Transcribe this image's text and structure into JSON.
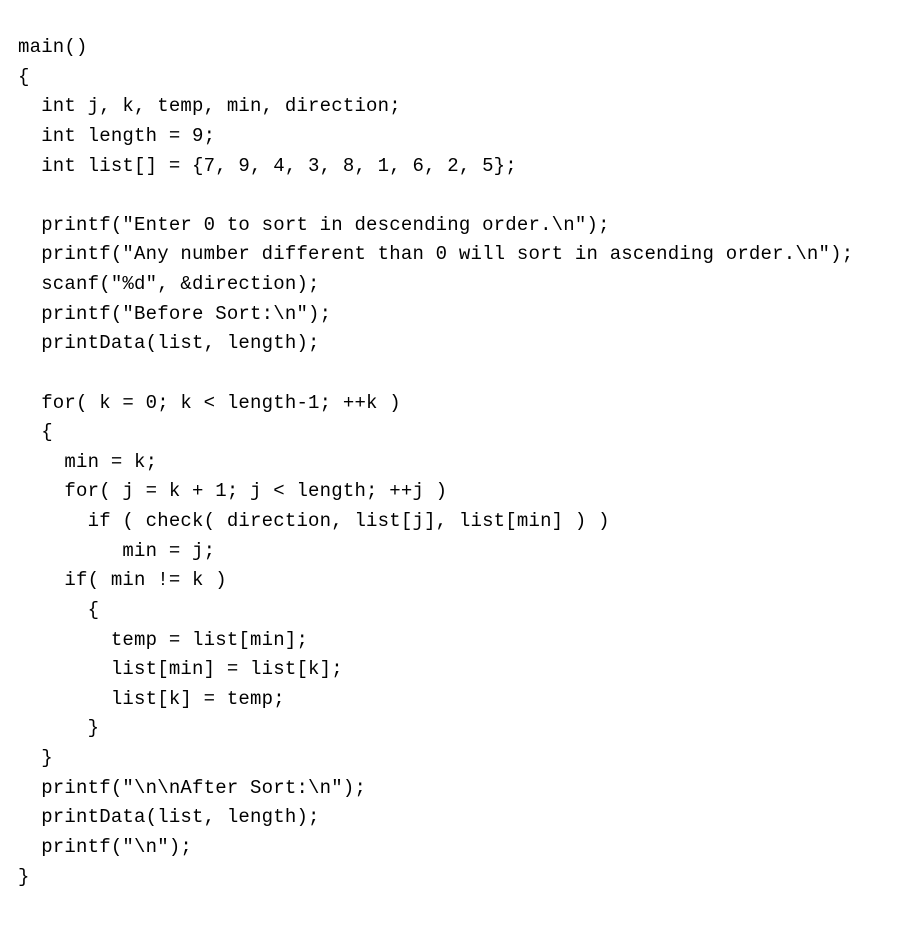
{
  "code": {
    "lines": [
      "main()",
      "{",
      "  int j, k, temp, min, direction;",
      "  int length = 9;",
      "  int list[] = {7, 9, 4, 3, 8, 1, 6, 2, 5};",
      "",
      "  printf(\"Enter 0 to sort in descending order.\\n\");",
      "  printf(\"Any number different than 0 will sort in ascending order.\\n\");",
      "  scanf(\"%d\", &direction);",
      "  printf(\"Before Sort:\\n\");",
      "  printData(list, length);",
      "",
      "  for( k = 0; k < length-1; ++k )",
      "  {",
      "    min = k;",
      "    for( j = k + 1; j < length; ++j )",
      "      if ( check( direction, list[j], list[min] ) )",
      "         min = j;",
      "    if( min != k )",
      "      {",
      "        temp = list[min];",
      "        list[min] = list[k];",
      "        list[k] = temp;",
      "      }",
      "  }",
      "  printf(\"\\n\\nAfter Sort:\\n\");",
      "  printData(list, length);",
      "  printf(\"\\n\");",
      "}"
    ]
  }
}
